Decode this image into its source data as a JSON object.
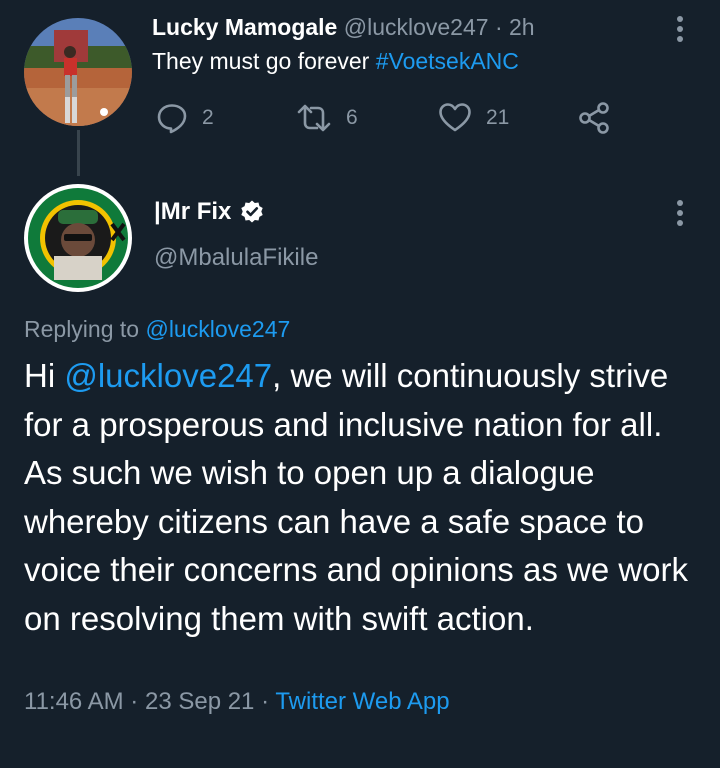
{
  "parent_tweet": {
    "display_name": "Lucky Mamogale",
    "handle": "@lucklove247",
    "separator": "·",
    "time_ago": "2h",
    "text": "They must go forever ",
    "hashtag": "#VoetsekANC",
    "actions": {
      "reply": {
        "icon": "reply-icon",
        "count": "2"
      },
      "retweet": {
        "icon": "retweet-icon",
        "count": "6"
      },
      "like": {
        "icon": "heart-icon",
        "count": "21"
      },
      "share": {
        "icon": "share-icon"
      }
    }
  },
  "main_tweet": {
    "display_name": "|Mr Fix",
    "handle": "@MbalulaFikile",
    "verified_icon": "verified-badge-icon",
    "replying_prefix": "Replying to",
    "replying_to": "@lucklove247",
    "body_prefix": "Hi ",
    "body_mention": "@lucklove247",
    "body_rest": ", we will continuously strive for a prosperous and inclusive nation for all. As such we wish to open up a dialogue whereby citizens can have a safe space to voice their concerns and opinions as we work on resolving them with swift action.",
    "time": "11:46 AM",
    "date": "23 Sep 21",
    "separator": "·",
    "source": "Twitter Web App"
  },
  "colors": {
    "background": "#15202b",
    "primary_text": "#ffffff",
    "secondary_text": "#8b98a5",
    "link": "#1d9bf0",
    "thread_line": "#38444d"
  }
}
